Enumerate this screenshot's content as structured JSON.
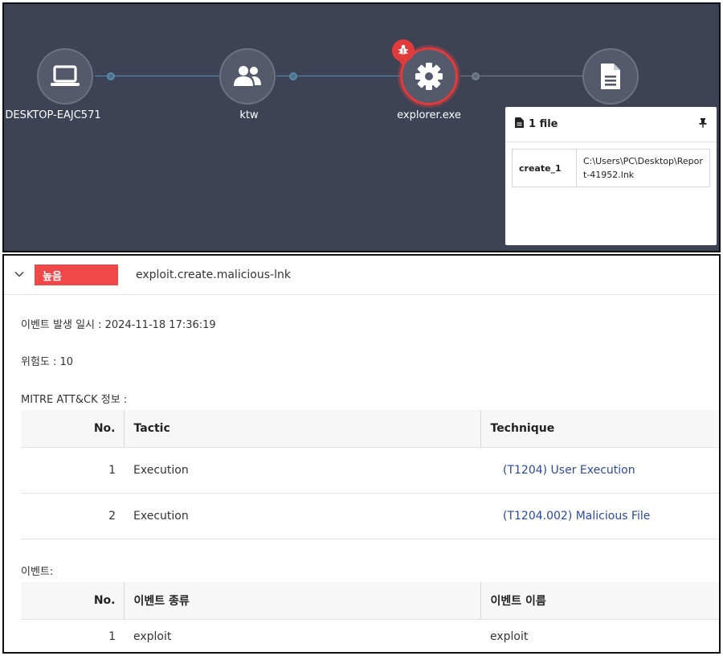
{
  "graph": {
    "nodes": [
      {
        "label": "DESKTOP-EAJC571",
        "icon": "laptop-icon"
      },
      {
        "label": "ktw",
        "icon": "users-icon"
      },
      {
        "label": "explorer.exe",
        "icon": "gear-icon",
        "badge": "bug-icon"
      },
      {
        "label": "",
        "icon": "file-icon"
      }
    ],
    "colors": {
      "background": "#3d4255",
      "edge": "#4f8fb3",
      "selected": "#e23b3b"
    }
  },
  "file_popup": {
    "title": "1 file",
    "rows": [
      {
        "key": "create_1",
        "value": "C:\\Users\\PC\\Desktop\\Report-41952.lnk"
      }
    ]
  },
  "alert": {
    "severity": "높음",
    "severity_color": "#f04848",
    "name": "exploit.create.malicious-lnk",
    "event_time": "이벤트 발생 일시 : 2024-11-18 17:36:19",
    "risk": "위험도 : 10",
    "mitre_title": "MITRE ATT&CK 정보 :",
    "mitre_table": {
      "headers": {
        "no": "No.",
        "tactic": "Tactic",
        "technique": "Technique"
      },
      "rows": [
        {
          "no": "1",
          "tactic": "Execution",
          "technique": "(T1204) User Execution"
        },
        {
          "no": "2",
          "tactic": "Execution",
          "technique": "(T1204.002) Malicious File"
        }
      ]
    },
    "events_title": "이벤트:",
    "events_table": {
      "headers": {
        "no": "No.",
        "type": "이벤트 종류",
        "name": "이벤트 이름"
      },
      "rows": [
        {
          "no": "1",
          "type": "exploit",
          "name": "exploit"
        }
      ]
    }
  }
}
